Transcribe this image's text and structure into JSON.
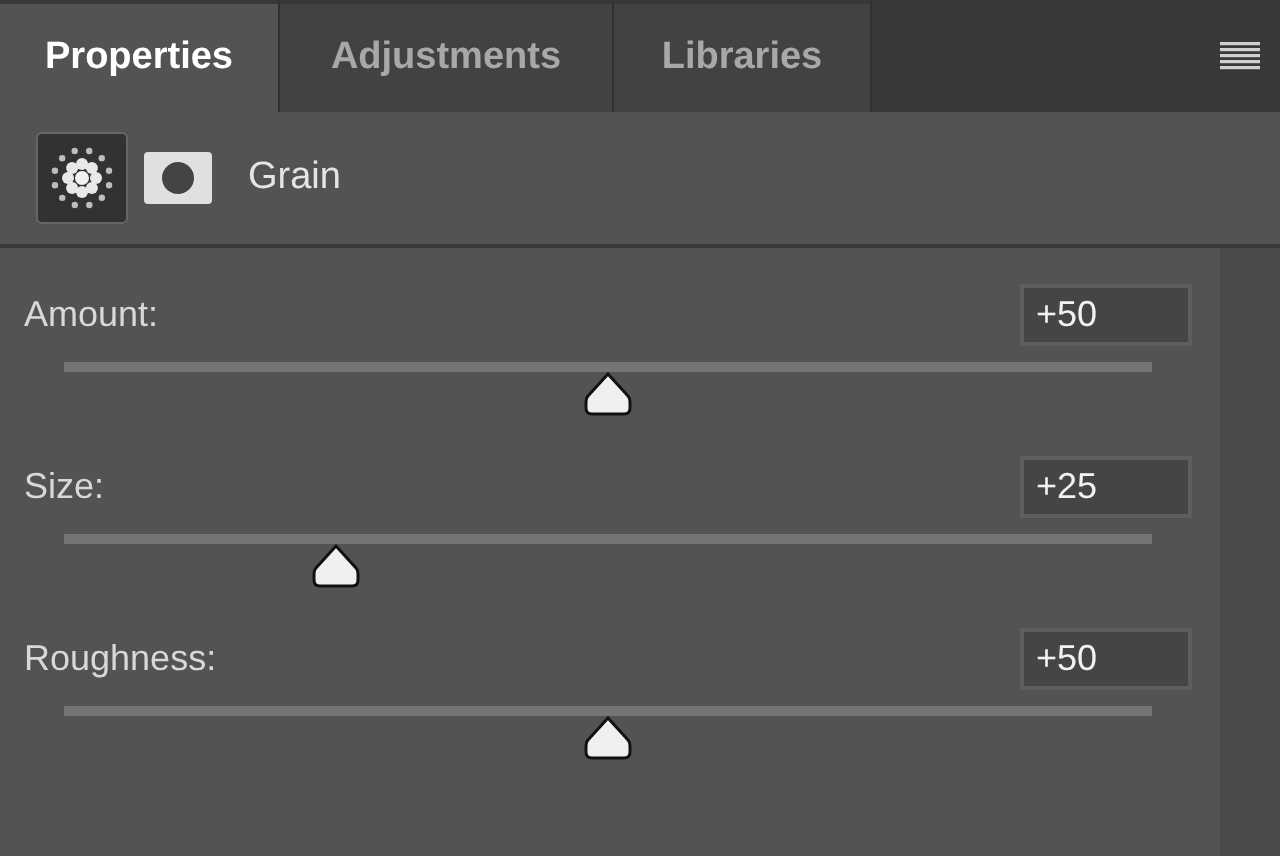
{
  "tabs": [
    {
      "label": "Properties",
      "selected": true
    },
    {
      "label": "Adjustments",
      "selected": false
    },
    {
      "label": "Libraries",
      "selected": false
    }
  ],
  "header": {
    "title": "Grain"
  },
  "sliders": [
    {
      "label": "Amount:",
      "value": "+50",
      "level": 0.5
    },
    {
      "label": "Size:",
      "value": "+25",
      "level": 0.25
    },
    {
      "label": "Roughness:",
      "value": "+50",
      "level": 0.5
    }
  ]
}
